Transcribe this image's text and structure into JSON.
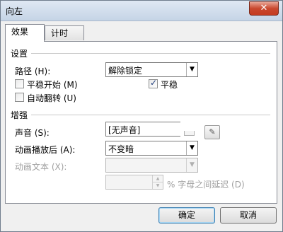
{
  "window": {
    "title": "向左",
    "close_glyph": "✕"
  },
  "tabs": [
    {
      "label": "效果",
      "active": true
    },
    {
      "label": "计时",
      "active": false
    }
  ],
  "settings": {
    "heading": "设置",
    "path_label": "路径 (H):",
    "path_value": "解除锁定",
    "smooth_start_label": "平稳开始 (M)",
    "smooth_start_checked": false,
    "smooth_label": "平稳",
    "smooth_checked": true,
    "auto_reverse_label": "自动翻转 (U)",
    "auto_reverse_checked": false
  },
  "enhancements": {
    "heading": "增强",
    "sound_label": "声音 (S):",
    "sound_value": "[无声音]",
    "after_anim_label": "动画播放后 (A):",
    "after_anim_value": "不变暗",
    "anim_text_label": "动画文本 (X):",
    "anim_text_value": "",
    "delay_value": "",
    "delay_suffix": "% 字母之间延迟 (D)"
  },
  "buttons": {
    "ok": "确定",
    "cancel": "取消"
  },
  "icons": {
    "dropdown": "▼",
    "spin_up": "▲",
    "spin_down": "▼",
    "speaker": "✎"
  }
}
